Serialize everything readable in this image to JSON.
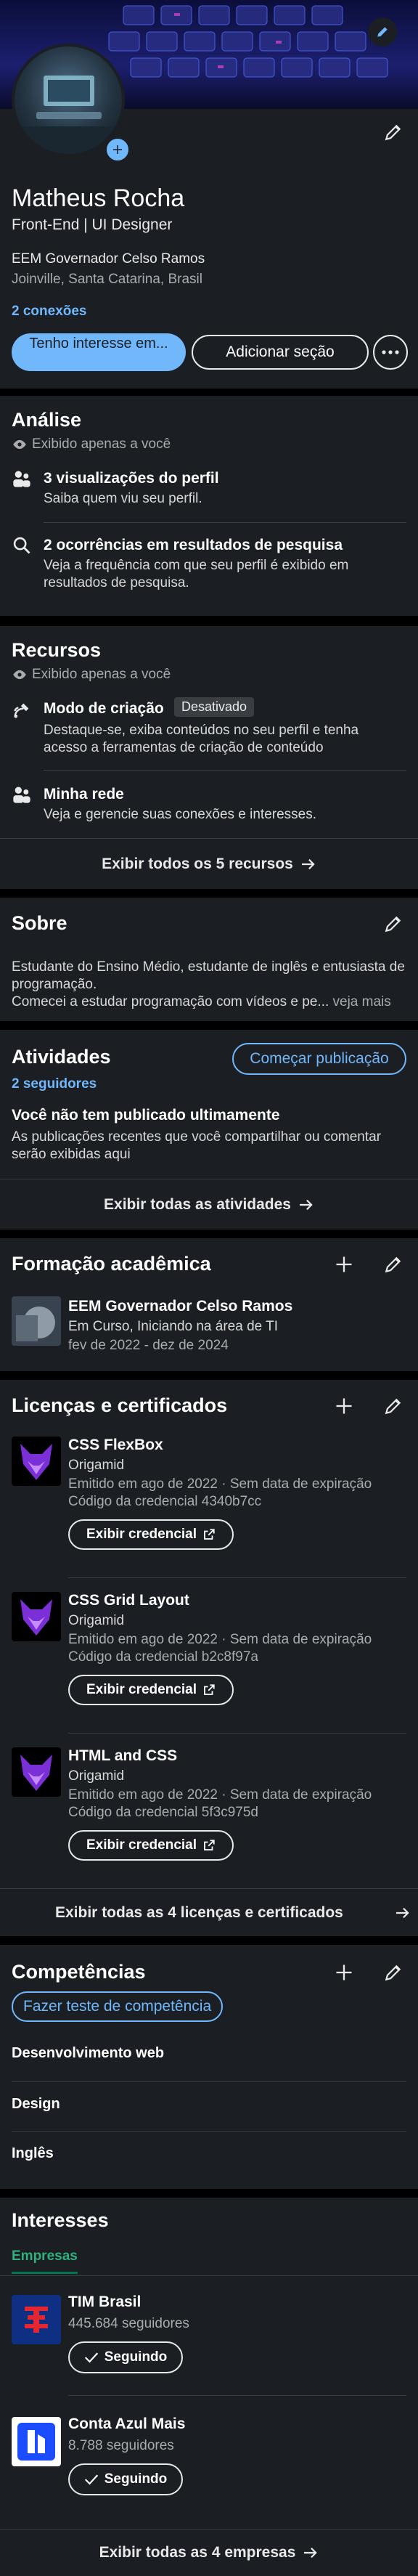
{
  "profile": {
    "name": "Matheus Rocha",
    "headline": "Front-End | UI Designer",
    "school": "EEM Governador Celso Ramos",
    "location": "Joinville, Santa Catarina, Brasil",
    "connections": "2 conexões",
    "btn_interest": "Tenho interesse em...",
    "btn_add_section": "Adicionar seção"
  },
  "analytics": {
    "title": "Análise",
    "visibility": "Exibido apenas a você",
    "items": [
      {
        "title": "3 visualizações do perfil",
        "desc": "Saiba quem viu seu perfil."
      },
      {
        "title": "2 ocorrências em resultados de pesquisa",
        "desc": "Veja a frequência com que seu perfil é exibido em resultados de pesquisa."
      }
    ]
  },
  "resources": {
    "title": "Recursos",
    "visibility": "Exibido apenas a você",
    "creator_title": "Modo de criação",
    "creator_badge": "Desativado",
    "creator_desc": "Destaque-se, exiba conteúdos no seu perfil e tenha acesso a ferramentas de criação de conteúdo",
    "network_title": "Minha rede",
    "network_desc": "Veja e gerencie suas conexões e interesses.",
    "footer": "Exibir todos os 5 recursos"
  },
  "about": {
    "title": "Sobre",
    "text": "Estudante do Ensino Médio, estudante de inglês e entusiasta de programação.",
    "text2": "Comecei a estudar programação com vídeos e pe...",
    "more": "veja mais"
  },
  "activity": {
    "title": "Atividades",
    "followers": "2 seguidores",
    "btn_post": "Começar publicação",
    "empty_title": "Você não tem publicado ultimamente",
    "empty_desc": "As publicações recentes que você compartilhar ou comentar serão exibidas aqui",
    "footer": "Exibir todas as atividades"
  },
  "education": {
    "title": "Formação acadêmica",
    "school": "EEM Governador Celso Ramos",
    "degree": "Em Curso, Iniciando na área de TI",
    "dates": "fev de 2022 - dez de 2024"
  },
  "licenses": {
    "title": "Licenças e certificados",
    "items": [
      {
        "name": "CSS FlexBox",
        "issuer": "Origamid",
        "issued": "Emitido em ago de 2022 · Sem data de expiração",
        "credential": "Código da credencial 4340b7cc",
        "button": "Exibir credencial"
      },
      {
        "name": "CSS Grid Layout",
        "issuer": "Origamid",
        "issued": "Emitido em ago de 2022 · Sem data de expiração",
        "credential": "Código da credencial b2c8f97a",
        "button": "Exibir credencial"
      },
      {
        "name": "HTML and CSS",
        "issuer": "Origamid",
        "issued": "Emitido em ago de 2022 · Sem data de expiração",
        "credential": "Código da credencial 5f3c975d",
        "button": "Exibir credencial"
      }
    ],
    "footer": "Exibir todas as 4 licenças e certificados"
  },
  "skills": {
    "title": "Competências",
    "btn_test": "Fazer teste de competência",
    "items": [
      "Desenvolvimento web",
      "Design",
      "Inglês"
    ]
  },
  "interests": {
    "title": "Interesses",
    "tab": "Empresas",
    "items": [
      {
        "name": "TIM Brasil",
        "followers": "445.684 seguidores",
        "button": "Seguindo"
      },
      {
        "name": "Conta Azul Mais",
        "followers": "8.788 seguidores",
        "button": "Seguindo"
      }
    ],
    "footer": "Exibir todas as 4 empresas"
  },
  "colors": {
    "accent": "#71b7fb",
    "card": "#1b1f23",
    "green": "#01754f"
  }
}
